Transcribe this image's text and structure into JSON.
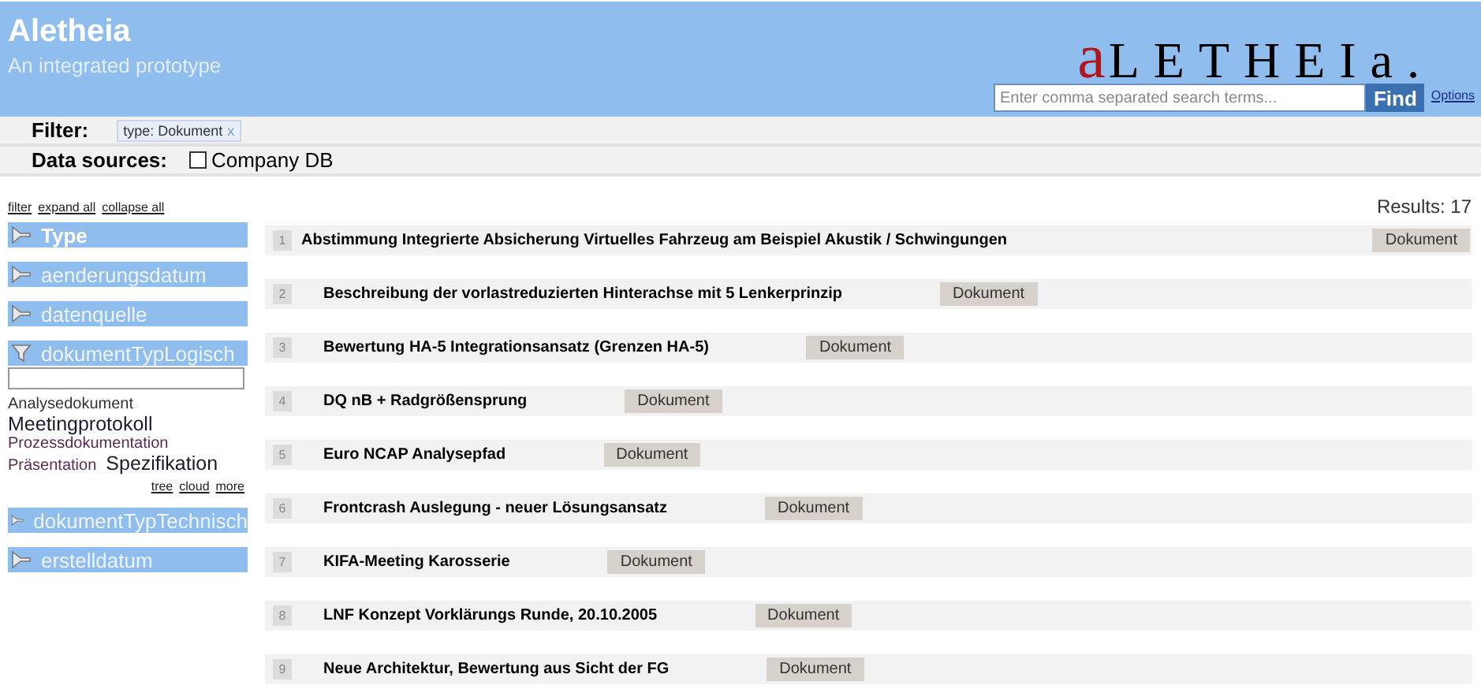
{
  "header": {
    "title": "Aletheia",
    "subtitle": "An integrated prototype",
    "logo": {
      "accent": "a",
      "rest": "LETHEIa."
    },
    "search": {
      "placeholder": "Enter comma separated search terms...",
      "button": "Find"
    },
    "options_link": "Options"
  },
  "filter_bar": {
    "label": "Filter:",
    "chips": [
      {
        "label": "type: Dokument",
        "remove": "x"
      }
    ]
  },
  "data_sources": {
    "label": "Data sources:",
    "sources": [
      {
        "label": "Company DB",
        "checked": false
      }
    ]
  },
  "sidebar": {
    "links": [
      "filter",
      "expand all",
      "collapse all"
    ],
    "facets": [
      {
        "label": "Type",
        "expanded": false,
        "kind": "primary"
      },
      {
        "label": "aenderungsdatum",
        "expanded": false,
        "kind": "normal"
      },
      {
        "label": "datenquelle",
        "expanded": false,
        "kind": "normal"
      },
      {
        "label": "dokumentTypLogisch",
        "expanded": true,
        "kind": "normal",
        "cloud": [
          {
            "label": "Analysedokument",
            "kind": "small",
            "color": "#333333"
          },
          {
            "label": "Meetingprotokoll",
            "kind": "large",
            "color": "#1a1a2e"
          },
          {
            "label": "Prozessdokumentation",
            "kind": "small",
            "color": "#5a2a55"
          },
          {
            "label": "Präsentation",
            "kind": "small",
            "color": "#5a2a55"
          },
          {
            "label": "Spezifikation",
            "kind": "large",
            "color": "#1a1a2e"
          }
        ],
        "views": [
          "tree",
          "cloud",
          "more"
        ]
      },
      {
        "label": "dokumentTypTechnisch",
        "expanded": false,
        "kind": "normal"
      },
      {
        "label": "erstelldatum",
        "expanded": false,
        "kind": "normal"
      }
    ]
  },
  "results": {
    "count_label": "Results: 17",
    "rows": [
      {
        "number": "1",
        "title": "Abstimmung Integrierte Absicherung Virtuelles Fahrzeug am Beispiel Akustik / Schwingungen",
        "tag": "Dokument"
      },
      {
        "number": "2",
        "title": "Beschreibung der vorlastreduzierten Hinterachse mit 5 Lenkerprinzip",
        "tag": "Dokument"
      },
      {
        "number": "3",
        "title": "Bewertung HA-5 Integrationsansatz (Grenzen HA-5)",
        "tag": "Dokument"
      },
      {
        "number": "4",
        "title": "DQ nB + Radgrößensprung",
        "tag": "Dokument"
      },
      {
        "number": "5",
        "title": "Euro NCAP Analysepfad",
        "tag": "Dokument"
      },
      {
        "number": "6",
        "title": "Frontcrash Auslegung - neuer Lösungsansatz",
        "tag": "Dokument"
      },
      {
        "number": "7",
        "title": "KIFA-Meeting Karosserie",
        "tag": "Dokument"
      },
      {
        "number": "8",
        "title": "LNF Konzept Vorklärungs Runde, 20.10.2005",
        "tag": "Dokument"
      },
      {
        "number": "9",
        "title": "Neue Architektur, Bewertung aus Sicht der FG",
        "tag": "Dokument"
      }
    ]
  }
}
